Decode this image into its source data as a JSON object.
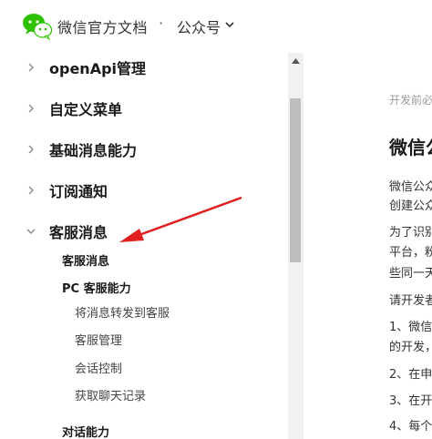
{
  "header": {
    "brand": "微信官方文档",
    "separator": "·",
    "product": "公众号",
    "logo_icon": "wechat-logo-icon",
    "chevron_icon": "chevron-down-icon"
  },
  "sidebar": {
    "items": [
      {
        "label": "openApi管理",
        "expanded": false
      },
      {
        "label": "自定义菜单",
        "expanded": false
      },
      {
        "label": "基础消息能力",
        "expanded": false
      },
      {
        "label": "订阅通知",
        "expanded": false
      },
      {
        "label": "客服消息",
        "expanded": true
      }
    ],
    "sub": {
      "kefu": "客服消息",
      "pc": "PC 客服能力",
      "forward": "将消息转发到客服",
      "manage": "客服管理",
      "session": "会话控制",
      "history": "获取聊天记录",
      "dialog": "对话能力"
    }
  },
  "content": {
    "breadcrumb": "开发前必",
    "title": "微信公",
    "lines": [
      "微信公众",
      "创建公众",
      "为了识别",
      "平台，粉",
      "些同一天",
      "请开发者",
      "1、微信",
      "的开发，",
      "2、在申",
      "3、在开",
      "4、每个"
    ]
  },
  "colors": {
    "accent_arrow": "#e02020",
    "scroll_thumb": "#bdbdbd"
  }
}
